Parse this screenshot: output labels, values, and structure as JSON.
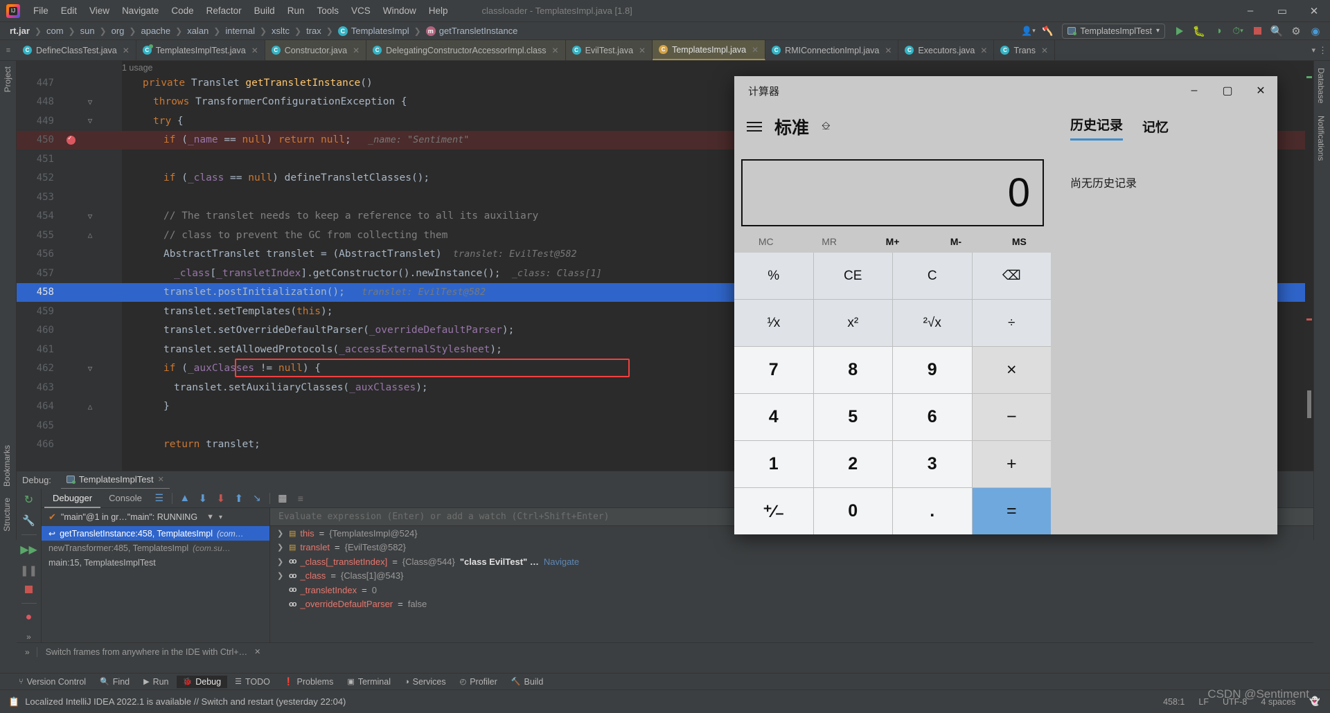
{
  "window": {
    "title": "classloader - TemplatesImpl.java [1.8]",
    "minimize": "–",
    "maximize": "▭",
    "close": "✕"
  },
  "menu": {
    "items": [
      "File",
      "Edit",
      "View",
      "Navigate",
      "Code",
      "Refactor",
      "Build",
      "Run",
      "Tools",
      "VCS",
      "Window",
      "Help"
    ]
  },
  "breadcrumb": {
    "items": [
      {
        "label": "rt.jar",
        "icon": "",
        "bold": true
      },
      {
        "label": "com",
        "icon": ""
      },
      {
        "label": "sun",
        "icon": ""
      },
      {
        "label": "org",
        "icon": ""
      },
      {
        "label": "apache",
        "icon": ""
      },
      {
        "label": "xalan",
        "icon": ""
      },
      {
        "label": "internal",
        "icon": ""
      },
      {
        "label": "xsltc",
        "icon": ""
      },
      {
        "label": "trax",
        "icon": ""
      },
      {
        "label": "TemplatesImpl",
        "icon": "class-icon",
        "glyph": "C"
      },
      {
        "label": "getTransletInstance",
        "icon": "method-icon",
        "glyph": "m"
      }
    ]
  },
  "toolbar": {
    "run_config": "TemplatesImplTest",
    "dropdown_caret": "▾",
    "run_label": "Run",
    "debug_label": "Debug",
    "coverage_label": "Run with Coverage",
    "profile_label": "Profiler",
    "stop_label": "Stop",
    "search_label": "Search Everywhere",
    "settings_label": "Settings"
  },
  "tabs": [
    {
      "label": "DefineClassTest.java",
      "icon": "java-class-icon",
      "active": false,
      "grouped": false
    },
    {
      "label": "TemplatesImplTest.java",
      "icon": "java-test-icon",
      "active": false,
      "grouped": false
    },
    {
      "label": "Constructor.java",
      "icon": "java-class-icon",
      "active": false,
      "grouped": true
    },
    {
      "label": "DelegatingConstructorAccessorImpl.class",
      "icon": "java-class-icon",
      "active": false,
      "grouped": true
    },
    {
      "label": "EvilTest.java",
      "icon": "java-class-icon",
      "active": false,
      "grouped": true
    },
    {
      "label": "TemplatesImpl.java",
      "icon": "java-class-icon",
      "active": true,
      "grouped": true
    },
    {
      "label": "RMIConnectionImpl.java",
      "icon": "java-class-icon",
      "active": false,
      "grouped": false
    },
    {
      "label": "Executors.java",
      "icon": "java-class-icon",
      "active": false,
      "grouped": false
    },
    {
      "label": "Trans",
      "icon": "java-class-icon",
      "active": false,
      "grouped": false
    }
  ],
  "editor": {
    "usage_label": "1 usage",
    "lines": [
      {
        "num": "447",
        "indent": 2,
        "fold": "",
        "segments": [
          {
            "t": "private ",
            "c": "kw"
          },
          {
            "t": "Translet ",
            "c": ""
          },
          {
            "t": "getTransletInstance",
            "c": "fn"
          },
          {
            "t": "()",
            "c": ""
          }
        ]
      },
      {
        "num": "448",
        "indent": 3,
        "fold": "down",
        "segments": [
          {
            "t": "throws ",
            "c": "kw"
          },
          {
            "t": "TransformerConfigurationException {",
            "c": ""
          }
        ]
      },
      {
        "num": "449",
        "indent": 3,
        "fold": "down",
        "segments": [
          {
            "t": "try ",
            "c": "kw"
          },
          {
            "t": "{",
            "c": ""
          }
        ]
      },
      {
        "num": "450",
        "indent": 4,
        "fold": "",
        "breakpoint": true,
        "hl": "red",
        "segments": [
          {
            "t": "if ",
            "c": "kw"
          },
          {
            "t": "(",
            "c": ""
          },
          {
            "t": "_name",
            "c": "fld"
          },
          {
            "t": " == ",
            "c": ""
          },
          {
            "t": "null",
            "c": "kw"
          },
          {
            "t": ") ",
            "c": ""
          },
          {
            "t": "return ",
            "c": "kw"
          },
          {
            "t": "null",
            "c": "kw"
          },
          {
            "t": ";",
            "c": ""
          },
          {
            "t": "   _name: \"Sentiment\"",
            "c": "hint"
          }
        ]
      },
      {
        "num": "451",
        "indent": 0,
        "fold": "",
        "segments": []
      },
      {
        "num": "452",
        "indent": 4,
        "fold": "",
        "segments": [
          {
            "t": "if ",
            "c": "kw"
          },
          {
            "t": "(",
            "c": ""
          },
          {
            "t": "_class",
            "c": "fld"
          },
          {
            "t": " == ",
            "c": ""
          },
          {
            "t": "null",
            "c": "kw"
          },
          {
            "t": ") defineTransletClasses();",
            "c": ""
          }
        ]
      },
      {
        "num": "453",
        "indent": 0,
        "fold": "",
        "segments": []
      },
      {
        "num": "454",
        "indent": 4,
        "fold": "down",
        "segments": [
          {
            "t": "// The translet needs to keep a reference to all its auxiliary",
            "c": "cmt"
          }
        ]
      },
      {
        "num": "455",
        "indent": 4,
        "fold": "up",
        "segments": [
          {
            "t": "// class to prevent the GC from collecting them",
            "c": "cmt"
          }
        ]
      },
      {
        "num": "456",
        "indent": 4,
        "fold": "",
        "segments": [
          {
            "t": "AbstractTranslet translet = (AbstractTranslet)",
            "c": ""
          },
          {
            "t": "  translet: EvilTest@582",
            "c": "hint"
          }
        ]
      },
      {
        "num": "457",
        "indent": 5,
        "fold": "",
        "segments": [
          {
            "t": "_class",
            "c": "fld"
          },
          {
            "t": "[",
            "c": ""
          },
          {
            "t": "_transletIndex",
            "c": "fld"
          },
          {
            "t": "].getConstructor().newInstance()",
            "c": ""
          },
          {
            "t": ";",
            "c": ""
          },
          {
            "t": "  _class: Class[1]",
            "c": "hint"
          }
        ]
      },
      {
        "num": "458",
        "indent": 4,
        "fold": "",
        "hl": "sel",
        "segments": [
          {
            "t": "translet.postInitialization();",
            "c": ""
          },
          {
            "t": "   translet: EvilTest@582",
            "c": "hint"
          }
        ]
      },
      {
        "num": "459",
        "indent": 4,
        "fold": "",
        "segments": [
          {
            "t": "translet.setTemplates(",
            "c": ""
          },
          {
            "t": "this",
            "c": "kw"
          },
          {
            "t": ");",
            "c": ""
          }
        ]
      },
      {
        "num": "460",
        "indent": 4,
        "fold": "",
        "segments": [
          {
            "t": "translet.setOverrideDefaultParser(",
            "c": ""
          },
          {
            "t": "_overrideDefaultParser",
            "c": "fld"
          },
          {
            "t": ");",
            "c": ""
          }
        ]
      },
      {
        "num": "461",
        "indent": 4,
        "fold": "",
        "segments": [
          {
            "t": "translet.setAllowedProtocols(",
            "c": ""
          },
          {
            "t": "_accessExternalStylesheet",
            "c": "fld"
          },
          {
            "t": ");",
            "c": ""
          }
        ]
      },
      {
        "num": "462",
        "indent": 4,
        "fold": "down",
        "segments": [
          {
            "t": "if ",
            "c": "kw"
          },
          {
            "t": "(",
            "c": ""
          },
          {
            "t": "_auxClasses",
            "c": "fld"
          },
          {
            "t": " != ",
            "c": ""
          },
          {
            "t": "null",
            "c": "kw"
          },
          {
            "t": ") {",
            "c": ""
          }
        ]
      },
      {
        "num": "463",
        "indent": 5,
        "fold": "",
        "segments": [
          {
            "t": "translet.setAuxiliaryClasses(",
            "c": ""
          },
          {
            "t": "_auxClasses",
            "c": "fld"
          },
          {
            "t": ");",
            "c": ""
          }
        ]
      },
      {
        "num": "464",
        "indent": 4,
        "fold": "up",
        "segments": [
          {
            "t": "}",
            "c": ""
          }
        ]
      },
      {
        "num": "465",
        "indent": 0,
        "fold": "",
        "segments": []
      },
      {
        "num": "466",
        "indent": 4,
        "fold": "",
        "segments": [
          {
            "t": "return ",
            "c": "kw"
          },
          {
            "t": "translet;",
            "c": ""
          }
        ]
      }
    ]
  },
  "debug": {
    "header_label": "Debug:",
    "session_name": "TemplatesImplTest",
    "close_glyph": "✕",
    "tabs": [
      {
        "label": "Debugger",
        "selected": true
      },
      {
        "label": "Console",
        "selected": false
      }
    ],
    "thread": "\"main\"@1 in gr…\"main\": RUNNING",
    "frames": [
      {
        "label": "getTransletInstance:458, TemplatesImpl",
        "pkg": "(com…",
        "selected": true
      },
      {
        "label": "newTransformer:485, TemplatesImpl",
        "pkg": "(com.su…",
        "selected": false,
        "dim": true
      },
      {
        "label": "main:15, TemplatesImplTest",
        "pkg": "",
        "selected": false
      }
    ],
    "evaluate_placeholder": "Evaluate expression (Enter) or add a watch (Ctrl+Shift+Enter)",
    "variables": [
      {
        "expand": true,
        "icon": "object-icon",
        "name": "this",
        "value": "{TemplatesImpl@524}",
        "extra": "",
        "link": ""
      },
      {
        "expand": true,
        "icon": "object-icon",
        "name": "translet",
        "value": "{EvilTest@582}",
        "extra": "",
        "link": ""
      },
      {
        "expand": true,
        "icon": "field-icon",
        "name": "_class[_transletIndex]",
        "value": "{Class@544}",
        "extra": "\"class EvilTest\" …",
        "link": "Navigate"
      },
      {
        "expand": true,
        "icon": "field-icon",
        "name": "_class",
        "value": "{Class[1]@543}",
        "extra": "",
        "link": ""
      },
      {
        "expand": false,
        "icon": "field-icon",
        "name": "_transletIndex",
        "value": "0",
        "extra": "",
        "link": ""
      },
      {
        "expand": false,
        "icon": "field-icon",
        "name": "_overrideDefaultParser",
        "value": "false",
        "extra": "",
        "link": ""
      }
    ],
    "hint_text": "Switch frames from anywhere in the IDE with Ctrl+…",
    "hint_close": "✕",
    "expand_glyph": "»"
  },
  "toolwindows": {
    "left_top": "Project",
    "left_bottom": [
      "Bookmarks",
      "Structure"
    ],
    "right_top": [
      "Database",
      "Notifications"
    ],
    "bottom": [
      {
        "label": "Version Control",
        "icon": "branch-icon",
        "active": false
      },
      {
        "label": "Find",
        "icon": "search-icon",
        "active": false
      },
      {
        "label": "Run",
        "icon": "play-icon",
        "active": false
      },
      {
        "label": "Debug",
        "icon": "bug-icon",
        "active": true
      },
      {
        "label": "TODO",
        "icon": "list-icon",
        "active": false
      },
      {
        "label": "Problems",
        "icon": "warning-icon",
        "active": false
      },
      {
        "label": "Terminal",
        "icon": "terminal-icon",
        "active": false
      },
      {
        "label": "Services",
        "icon": "services-icon",
        "active": false
      },
      {
        "label": "Profiler",
        "icon": "profiler-icon",
        "active": false
      },
      {
        "label": "Build",
        "icon": "hammer-icon",
        "active": false
      }
    ]
  },
  "statusbar": {
    "message": "Localized IntelliJ IDEA 2022.1 is available // Switch and restart (yesterday 22:04)",
    "caret": "458:1",
    "line_sep": "LF",
    "encoding": "UTF-8",
    "indent": "4 spaces"
  },
  "watermark": "CSDN @Sentiment",
  "calculator": {
    "title": "计算器",
    "minimize": "–",
    "maximize": "▢",
    "close": "✕",
    "mode": "标准",
    "pin_icon": "keep-on-top-icon",
    "menu_icon": "hamburger-icon",
    "display": "0",
    "memory_buttons": [
      {
        "label": "MC",
        "enabled": false
      },
      {
        "label": "MR",
        "enabled": false
      },
      {
        "label": "M+",
        "enabled": true
      },
      {
        "label": "M-",
        "enabled": true
      },
      {
        "label": "MS",
        "enabled": true
      }
    ],
    "keys": [
      {
        "label": "%",
        "kind": "fn",
        "name": "percent"
      },
      {
        "label": "CE",
        "kind": "fn",
        "name": "clear-entry"
      },
      {
        "label": "C",
        "kind": "fn",
        "name": "clear"
      },
      {
        "label": "⌫",
        "kind": "fn",
        "name": "backspace"
      },
      {
        "label": "¹⁄x",
        "kind": "fn",
        "name": "reciprocal"
      },
      {
        "label": "x²",
        "kind": "fn",
        "name": "square"
      },
      {
        "label": "²√x",
        "kind": "fn",
        "name": "square-root"
      },
      {
        "label": "÷",
        "kind": "fn",
        "name": "divide"
      },
      {
        "label": "7",
        "kind": "num",
        "name": "digit-7"
      },
      {
        "label": "8",
        "kind": "num",
        "name": "digit-8"
      },
      {
        "label": "9",
        "kind": "num",
        "name": "digit-9"
      },
      {
        "label": "×",
        "kind": "op",
        "name": "multiply"
      },
      {
        "label": "4",
        "kind": "num",
        "name": "digit-4"
      },
      {
        "label": "5",
        "kind": "num",
        "name": "digit-5"
      },
      {
        "label": "6",
        "kind": "num",
        "name": "digit-6"
      },
      {
        "label": "−",
        "kind": "op",
        "name": "subtract"
      },
      {
        "label": "1",
        "kind": "num",
        "name": "digit-1"
      },
      {
        "label": "2",
        "kind": "num",
        "name": "digit-2"
      },
      {
        "label": "3",
        "kind": "num",
        "name": "digit-3"
      },
      {
        "label": "+",
        "kind": "op",
        "name": "add"
      },
      {
        "label": "⁺∕₋",
        "kind": "num",
        "name": "sign-toggle"
      },
      {
        "label": "0",
        "kind": "num",
        "name": "digit-0"
      },
      {
        "label": ".",
        "kind": "num",
        "name": "decimal-point"
      },
      {
        "label": "=",
        "kind": "eq",
        "name": "equals"
      }
    ],
    "side_tabs": [
      {
        "label": "历史记录",
        "selected": true
      },
      {
        "label": "记忆",
        "selected": false
      }
    ],
    "history_empty": "尚无历史记录",
    "accent_color": "#3a8ed0"
  }
}
